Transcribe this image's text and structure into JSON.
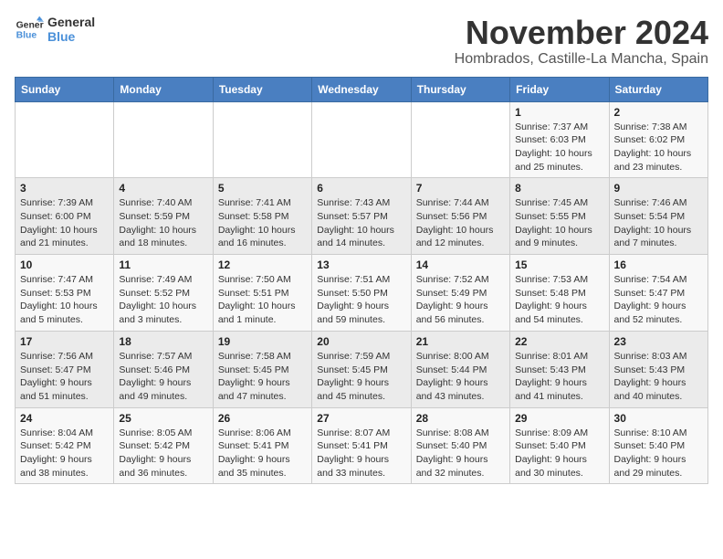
{
  "logo": {
    "line1": "General",
    "line2": "Blue"
  },
  "title": "November 2024",
  "subtitle": "Hombrados, Castille-La Mancha, Spain",
  "days_of_week": [
    "Sunday",
    "Monday",
    "Tuesday",
    "Wednesday",
    "Thursday",
    "Friday",
    "Saturday"
  ],
  "weeks": [
    [
      {
        "day": "",
        "info": ""
      },
      {
        "day": "",
        "info": ""
      },
      {
        "day": "",
        "info": ""
      },
      {
        "day": "",
        "info": ""
      },
      {
        "day": "",
        "info": ""
      },
      {
        "day": "1",
        "info": "Sunrise: 7:37 AM\nSunset: 6:03 PM\nDaylight: 10 hours and 25 minutes."
      },
      {
        "day": "2",
        "info": "Sunrise: 7:38 AM\nSunset: 6:02 PM\nDaylight: 10 hours and 23 minutes."
      }
    ],
    [
      {
        "day": "3",
        "info": "Sunrise: 7:39 AM\nSunset: 6:00 PM\nDaylight: 10 hours and 21 minutes."
      },
      {
        "day": "4",
        "info": "Sunrise: 7:40 AM\nSunset: 5:59 PM\nDaylight: 10 hours and 18 minutes."
      },
      {
        "day": "5",
        "info": "Sunrise: 7:41 AM\nSunset: 5:58 PM\nDaylight: 10 hours and 16 minutes."
      },
      {
        "day": "6",
        "info": "Sunrise: 7:43 AM\nSunset: 5:57 PM\nDaylight: 10 hours and 14 minutes."
      },
      {
        "day": "7",
        "info": "Sunrise: 7:44 AM\nSunset: 5:56 PM\nDaylight: 10 hours and 12 minutes."
      },
      {
        "day": "8",
        "info": "Sunrise: 7:45 AM\nSunset: 5:55 PM\nDaylight: 10 hours and 9 minutes."
      },
      {
        "day": "9",
        "info": "Sunrise: 7:46 AM\nSunset: 5:54 PM\nDaylight: 10 hours and 7 minutes."
      }
    ],
    [
      {
        "day": "10",
        "info": "Sunrise: 7:47 AM\nSunset: 5:53 PM\nDaylight: 10 hours and 5 minutes."
      },
      {
        "day": "11",
        "info": "Sunrise: 7:49 AM\nSunset: 5:52 PM\nDaylight: 10 hours and 3 minutes."
      },
      {
        "day": "12",
        "info": "Sunrise: 7:50 AM\nSunset: 5:51 PM\nDaylight: 10 hours and 1 minute."
      },
      {
        "day": "13",
        "info": "Sunrise: 7:51 AM\nSunset: 5:50 PM\nDaylight: 9 hours and 59 minutes."
      },
      {
        "day": "14",
        "info": "Sunrise: 7:52 AM\nSunset: 5:49 PM\nDaylight: 9 hours and 56 minutes."
      },
      {
        "day": "15",
        "info": "Sunrise: 7:53 AM\nSunset: 5:48 PM\nDaylight: 9 hours and 54 minutes."
      },
      {
        "day": "16",
        "info": "Sunrise: 7:54 AM\nSunset: 5:47 PM\nDaylight: 9 hours and 52 minutes."
      }
    ],
    [
      {
        "day": "17",
        "info": "Sunrise: 7:56 AM\nSunset: 5:47 PM\nDaylight: 9 hours and 51 minutes."
      },
      {
        "day": "18",
        "info": "Sunrise: 7:57 AM\nSunset: 5:46 PM\nDaylight: 9 hours and 49 minutes."
      },
      {
        "day": "19",
        "info": "Sunrise: 7:58 AM\nSunset: 5:45 PM\nDaylight: 9 hours and 47 minutes."
      },
      {
        "day": "20",
        "info": "Sunrise: 7:59 AM\nSunset: 5:45 PM\nDaylight: 9 hours and 45 minutes."
      },
      {
        "day": "21",
        "info": "Sunrise: 8:00 AM\nSunset: 5:44 PM\nDaylight: 9 hours and 43 minutes."
      },
      {
        "day": "22",
        "info": "Sunrise: 8:01 AM\nSunset: 5:43 PM\nDaylight: 9 hours and 41 minutes."
      },
      {
        "day": "23",
        "info": "Sunrise: 8:03 AM\nSunset: 5:43 PM\nDaylight: 9 hours and 40 minutes."
      }
    ],
    [
      {
        "day": "24",
        "info": "Sunrise: 8:04 AM\nSunset: 5:42 PM\nDaylight: 9 hours and 38 minutes."
      },
      {
        "day": "25",
        "info": "Sunrise: 8:05 AM\nSunset: 5:42 PM\nDaylight: 9 hours and 36 minutes."
      },
      {
        "day": "26",
        "info": "Sunrise: 8:06 AM\nSunset: 5:41 PM\nDaylight: 9 hours and 35 minutes."
      },
      {
        "day": "27",
        "info": "Sunrise: 8:07 AM\nSunset: 5:41 PM\nDaylight: 9 hours and 33 minutes."
      },
      {
        "day": "28",
        "info": "Sunrise: 8:08 AM\nSunset: 5:40 PM\nDaylight: 9 hours and 32 minutes."
      },
      {
        "day": "29",
        "info": "Sunrise: 8:09 AM\nSunset: 5:40 PM\nDaylight: 9 hours and 30 minutes."
      },
      {
        "day": "30",
        "info": "Sunrise: 8:10 AM\nSunset: 5:40 PM\nDaylight: 9 hours and 29 minutes."
      }
    ]
  ]
}
